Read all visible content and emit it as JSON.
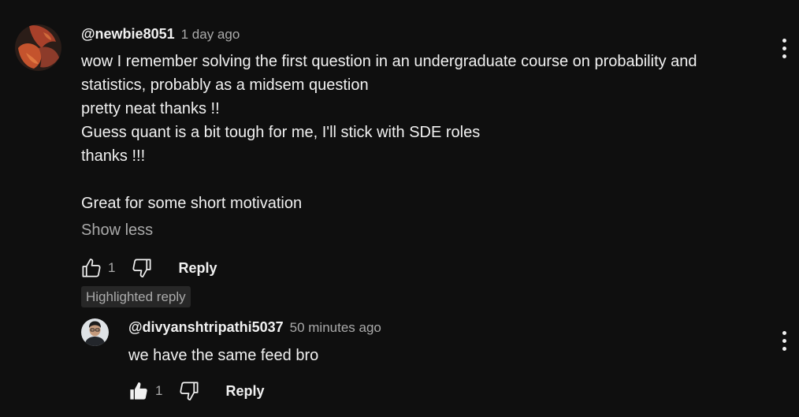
{
  "comments": [
    {
      "author": "@newbie8051",
      "time": "1 day ago",
      "lines": [
        "wow I remember solving the first question in an undergraduate course on probability and",
        "statistics, probably as a midsem question",
        "pretty neat thanks !!",
        "Guess quant is a bit tough for me, I'll stick with SDE roles",
        "thanks !!!",
        "",
        "Great for some short motivation"
      ],
      "show_less": "Show less",
      "likes": "1",
      "reply_label": "Reply",
      "highlight_badge": "Highlighted reply",
      "like_icon": "thumbs-up-outline",
      "dislike_icon": "thumbs-down-outline",
      "menu_icon": "vertical-ellipsis"
    },
    {
      "author": "@divyanshtripathi5037",
      "time": "50 minutes ago",
      "lines": [
        "we have the same feed bro"
      ],
      "likes": "1",
      "reply_label": "Reply",
      "like_icon": "thumbs-up-filled",
      "dislike_icon": "thumbs-down-outline",
      "menu_icon": "vertical-ellipsis"
    }
  ],
  "colors": {
    "background": "#0f0f0f",
    "text_primary": "#f1f1f1",
    "text_secondary": "#aaaaaa",
    "badge_background": "#272727"
  }
}
